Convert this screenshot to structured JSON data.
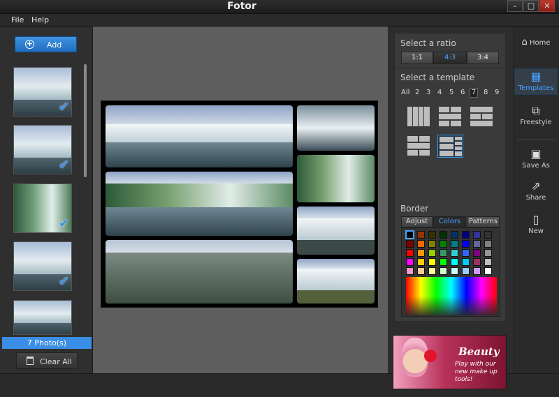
{
  "window": {
    "title": "Fotor",
    "controls": [
      "–",
      "□",
      "✕"
    ]
  },
  "menu": [
    "File",
    "Help"
  ],
  "left": {
    "add_label": "Add",
    "photo_count": "7 Photo(s)",
    "clear_label": "Clear All",
    "thumbnails": [
      {
        "checked": true
      },
      {
        "checked": true
      },
      {
        "checked": true
      },
      {
        "checked": true
      },
      {
        "checked": false
      }
    ]
  },
  "templates": {
    "ratio_label": "Select a ratio",
    "ratios": [
      "1:1",
      "4:3",
      "3:4"
    ],
    "ratio_selected": "4:3",
    "template_label": "Select a template",
    "counts": [
      "All",
      "2",
      "3",
      "4",
      "5",
      "6",
      "7",
      "8",
      "9"
    ],
    "count_selected": "7",
    "border_label": "Border",
    "border_tabs": [
      "Adjust",
      "Colors",
      "Patterns"
    ],
    "border_tab_selected": "Colors"
  },
  "palette": [
    [
      "#000000",
      "#993300",
      "#333300",
      "#003300",
      "#003366",
      "#000080",
      "#333399",
      "#333333"
    ],
    [
      "#800000",
      "#ff6600",
      "#808000",
      "#008000",
      "#008080",
      "#0000ff",
      "#666699",
      "#808080"
    ],
    [
      "#ff0000",
      "#ff9900",
      "#99cc00",
      "#339966",
      "#33cccc",
      "#3366ff",
      "#800080",
      "#969696"
    ],
    [
      "#ff00ff",
      "#ffcc00",
      "#ffff00",
      "#00ff00",
      "#00ffff",
      "#00ccff",
      "#993366",
      "#c0c0c0"
    ],
    [
      "#ff99cc",
      "#ffcc99",
      "#ffff99",
      "#ccffcc",
      "#ccffff",
      "#99ccff",
      "#cc99ff",
      "#ffffff"
    ]
  ],
  "ad": {
    "title": "Beauty",
    "text": "Play with our new make up tools!"
  },
  "nav": [
    {
      "label": "Home",
      "icon": "home-icon"
    },
    {
      "label": "Templates",
      "icon": "templates-icon",
      "active": true
    },
    {
      "label": "Freestyle",
      "icon": "freestyle-icon"
    },
    {
      "label": "Save As",
      "icon": "save-icon"
    },
    {
      "label": "Share",
      "icon": "share-icon"
    },
    {
      "label": "New",
      "icon": "new-icon"
    }
  ],
  "colors": {
    "accent": "#3a8ee6",
    "active_text": "#49a2ff"
  }
}
